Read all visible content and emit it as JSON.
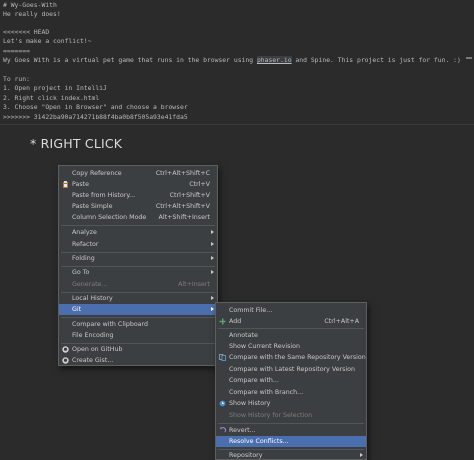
{
  "editor": {
    "lines": [
      "# Wy-Goes-With",
      "He really does!",
      "",
      "<<<<<<< HEAD",
      "Let's make a conflict!~",
      "=======",
      "Wy Goes With is a virtual pet game that runs in the browser using ",
      "phaser.io",
      " and Spine. This project is just for fun. :)",
      "",
      "To run:",
      "1. Open project in IntelliJ",
      "2. Right click index.html",
      "3. Choose \"Open in Browser\" and choose a browser",
      ">>>>>>> 31422ba90a714271b88f4ba0b8f505a93e41fda5"
    ]
  },
  "heading": "* RIGHT CLICK",
  "context_menu": {
    "copy_reference": {
      "label": "Copy Reference",
      "shortcut": "Ctrl+Alt+Shift+C"
    },
    "paste": {
      "label": "Paste",
      "shortcut": "Ctrl+V",
      "icon": "clipboard-icon"
    },
    "paste_from_history": {
      "label": "Paste from History...",
      "shortcut": "Ctrl+Shift+V"
    },
    "paste_simple": {
      "label": "Paste Simple",
      "shortcut": "Ctrl+Alt+Shift+V"
    },
    "column_selection_mode": {
      "label": "Column Selection Mode",
      "shortcut": "Alt+Shift+Insert"
    },
    "analyze": {
      "label": "Analyze"
    },
    "refactor": {
      "label": "Refactor"
    },
    "folding": {
      "label": "Folding"
    },
    "go_to": {
      "label": "Go To"
    },
    "generate": {
      "label": "Generate...",
      "shortcut": "Alt+Insert"
    },
    "local_history": {
      "label": "Local History"
    },
    "git": {
      "label": "Git"
    },
    "compare_with_clipboard": {
      "label": "Compare with Clipboard"
    },
    "file_encoding": {
      "label": "File Encoding"
    },
    "open_on_github": {
      "label": "Open on GitHub",
      "icon": "github-icon"
    },
    "create_gist": {
      "label": "Create Gist...",
      "icon": "github-icon"
    }
  },
  "git_menu": {
    "commit_file": {
      "label": "Commit File..."
    },
    "add": {
      "label": "Add",
      "shortcut": "Ctrl+Alt+A",
      "icon": "plus-icon"
    },
    "annotate": {
      "label": "Annotate"
    },
    "show_current_revision": {
      "label": "Show Current Revision"
    },
    "compare_same_repo": {
      "label": "Compare with the Same Repository Version",
      "icon": "diff-icon"
    },
    "compare_latest_repo": {
      "label": "Compare with Latest Repository Version"
    },
    "compare_with": {
      "label": "Compare with..."
    },
    "compare_with_branch": {
      "label": "Compare with Branch..."
    },
    "show_history": {
      "label": "Show History",
      "icon": "history-icon"
    },
    "show_history_selection": {
      "label": "Show History for Selection"
    },
    "revert": {
      "label": "Revert...",
      "icon": "revert-icon"
    },
    "resolve_conflicts": {
      "label": "Resolve Conflicts..."
    },
    "repository": {
      "label": "Repository"
    }
  },
  "colors": {
    "selection": "#4b6eaf",
    "menu_bg": "#3c3f41",
    "editor_bg": "#2b2b2b"
  }
}
